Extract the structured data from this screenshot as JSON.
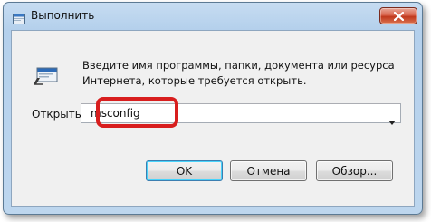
{
  "window": {
    "title": "Выполнить",
    "title_icon": "run-icon",
    "close_icon": "close-icon"
  },
  "dialog": {
    "prompt_line1": "Введите имя программы, папки, документа или ресурса",
    "prompt_line2": "Интернета, которые требуется открыть.",
    "open_label": "Открыть:",
    "open_value": "msconfig",
    "dropdown_icon": "chevron-down-icon",
    "annotation_color": "#d81e1e"
  },
  "buttons": {
    "ok": "OK",
    "cancel": "Отмена",
    "browse": "Обзор..."
  }
}
